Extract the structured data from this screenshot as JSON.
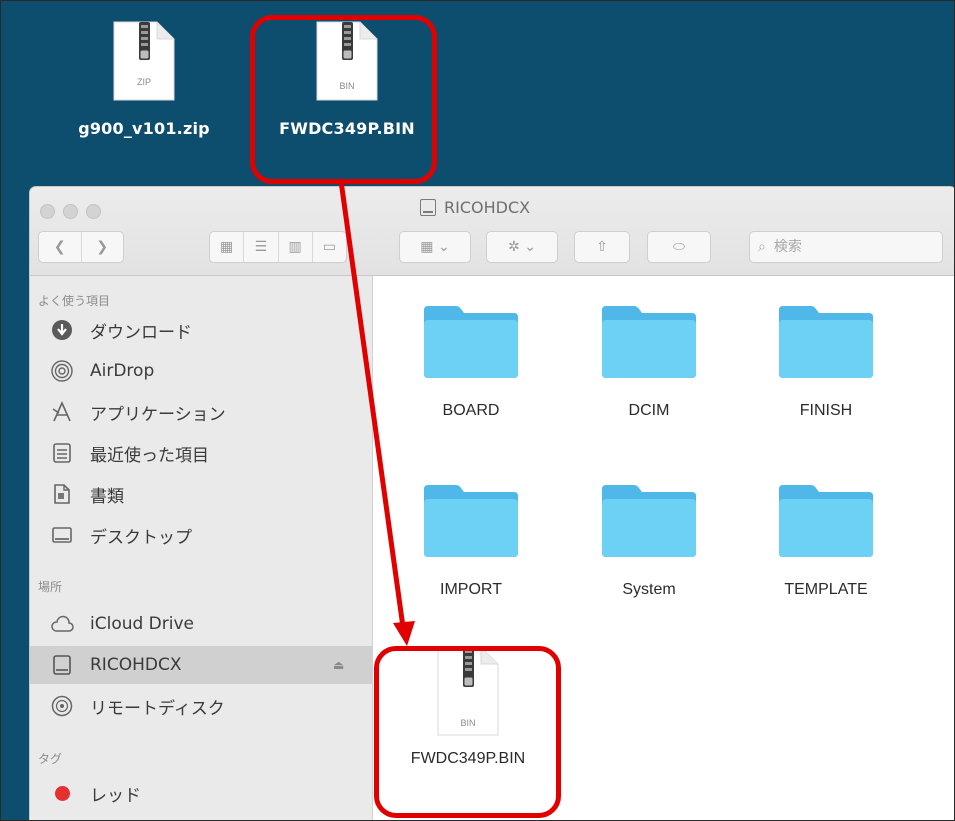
{
  "desktop": {
    "icons": [
      {
        "ext": "ZIP",
        "name": "g900_v101.zip"
      },
      {
        "ext": "BIN",
        "name": "FWDC349P.BIN"
      }
    ]
  },
  "window": {
    "title": "RICOHDCX",
    "search_placeholder": "検索"
  },
  "sidebar": {
    "favorites_header": "よく使う項目",
    "favorites": [
      {
        "label": "ダウンロード",
        "icon": "download-icon"
      },
      {
        "label": "AirDrop",
        "icon": "airdrop-icon"
      },
      {
        "label": "アプリケーション",
        "icon": "applications-icon"
      },
      {
        "label": "最近使った項目",
        "icon": "recents-icon"
      },
      {
        "label": "書類",
        "icon": "documents-icon"
      },
      {
        "label": "デスクトップ",
        "icon": "desktop-icon"
      }
    ],
    "locations_header": "場所",
    "locations": [
      {
        "label": "iCloud Drive",
        "icon": "icloud-icon"
      },
      {
        "label": "RICOHDCX",
        "icon": "drive-icon",
        "selected": true
      },
      {
        "label": "リモートディスク",
        "icon": "remote-disc-icon"
      }
    ],
    "tags_header": "タグ",
    "tags": [
      {
        "label": "レッド",
        "color": "#e53030"
      }
    ]
  },
  "content": {
    "folders": [
      "BOARD",
      "DCIM",
      "FINISH",
      "IMPORT",
      "System",
      "TEMPLATE"
    ],
    "file": {
      "ext": "BIN",
      "name": "FWDC349P.BIN"
    }
  },
  "colors": {
    "desktop_bg": "#0d4e6e",
    "folder_blue": "#5ac8f0",
    "highlight_red": "#e00000"
  }
}
